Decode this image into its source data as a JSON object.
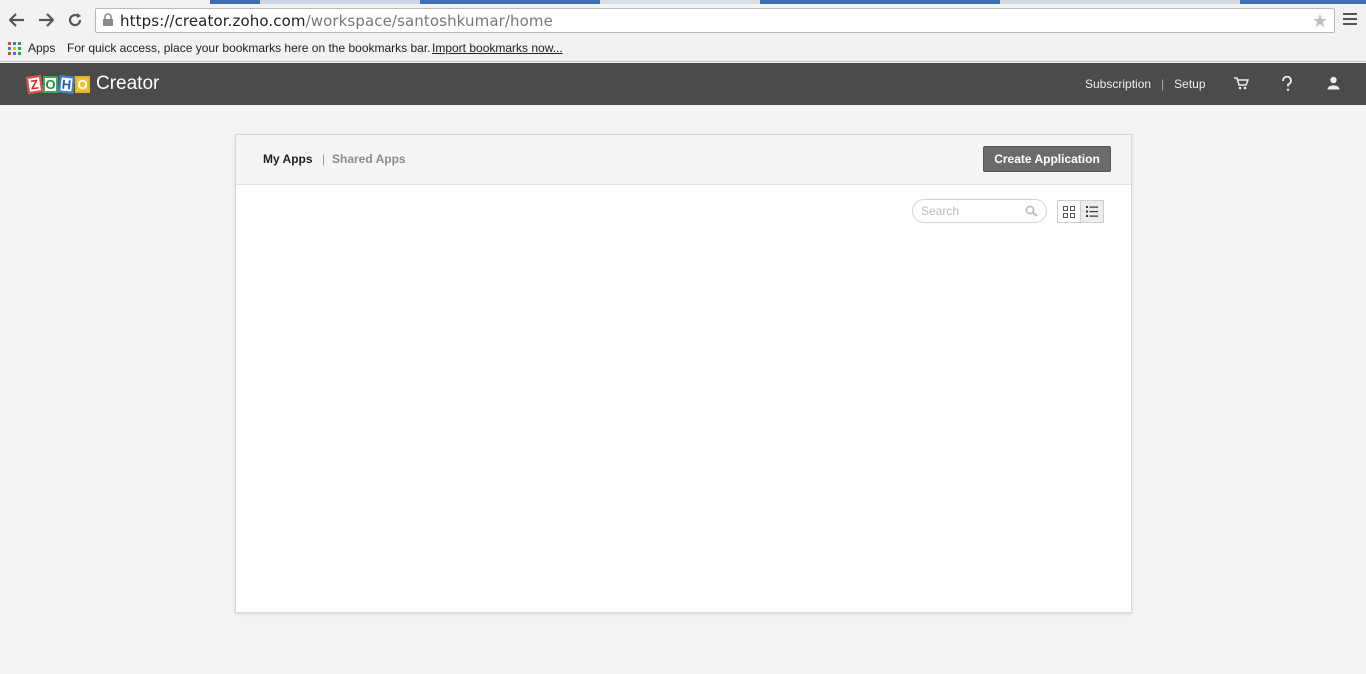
{
  "browser": {
    "url_host": "https://creator.zoho.com",
    "url_path": "/workspace/santoshkumar/home",
    "bookmarks_apps": "Apps",
    "bookmarks_hint": "For quick access, place your bookmarks here on the bookmarks bar.",
    "bookmarks_import": "Import bookmarks now..."
  },
  "header": {
    "logo_letters": [
      "Z",
      "O",
      "H",
      "O"
    ],
    "product_name": "Creator",
    "subscription": "Subscription",
    "separator": "|",
    "setup": "Setup",
    "icons": [
      "cart-icon",
      "help-icon",
      "user-icon"
    ]
  },
  "panel": {
    "tab_my_apps": "My Apps",
    "tab_separator": "|",
    "tab_shared_apps": "Shared Apps",
    "create_button": "Create Application",
    "search_placeholder": "Search",
    "view_modes": [
      "grid-view",
      "list-view"
    ],
    "active_view": "list-view"
  },
  "colors": {
    "appbar": "#4b4b4b",
    "create_button": "#6b6b6b",
    "page_background": "#f4f4f4"
  }
}
